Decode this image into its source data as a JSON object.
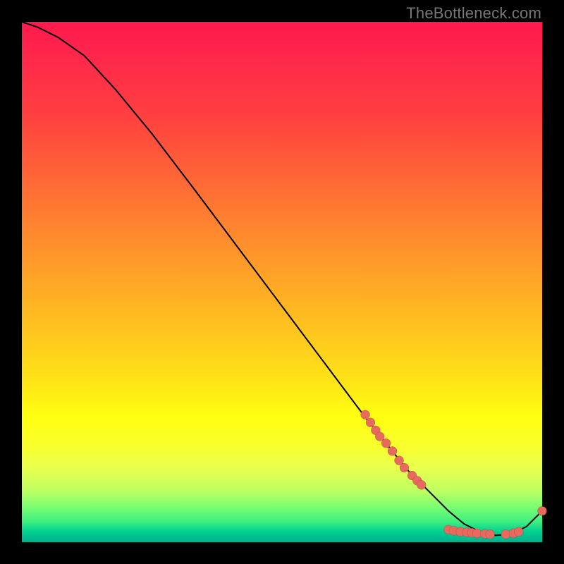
{
  "attribution": "TheBottleneck.com",
  "colors": {
    "dot": "#e86a5e",
    "curve": "#000000"
  },
  "chart_data": {
    "type": "line",
    "title": "",
    "xlabel": "",
    "ylabel": "",
    "xlim": [
      0,
      100
    ],
    "ylim": [
      0,
      100
    ],
    "grid": false,
    "series": [
      {
        "name": "bottleneck-curve",
        "x": [
          0,
          3,
          7,
          12,
          18,
          25,
          33,
          42,
          51,
          60,
          66,
          70,
          74,
          78,
          82,
          85,
          88,
          91,
          94,
          97,
          100
        ],
        "y": [
          100,
          99,
          97,
          93.5,
          87,
          78.5,
          68,
          56,
          44,
          32,
          24,
          19,
          14,
          10,
          6,
          3.5,
          2,
          1.3,
          1.5,
          3,
          6
        ]
      }
    ],
    "points": [
      {
        "name": "marker",
        "x": 66,
        "y": 24.5
      },
      {
        "name": "marker",
        "x": 67,
        "y": 23.0
      },
      {
        "name": "marker",
        "x": 68,
        "y": 21.5
      },
      {
        "name": "marker",
        "x": 68.8,
        "y": 20.3
      },
      {
        "name": "marker",
        "x": 70,
        "y": 19.0
      },
      {
        "name": "marker",
        "x": 71.2,
        "y": 17.5
      },
      {
        "name": "marker",
        "x": 72.5,
        "y": 15.7
      },
      {
        "name": "marker",
        "x": 73.5,
        "y": 14.3
      },
      {
        "name": "marker",
        "x": 75,
        "y": 12.8
      },
      {
        "name": "marker",
        "x": 76,
        "y": 11.8
      },
      {
        "name": "marker",
        "x": 76.8,
        "y": 11.0
      },
      {
        "name": "marker",
        "x": 82,
        "y": 2.4
      },
      {
        "name": "marker",
        "x": 83,
        "y": 2.2
      },
      {
        "name": "marker",
        "x": 84.3,
        "y": 2.0
      },
      {
        "name": "marker",
        "x": 85.5,
        "y": 1.9
      },
      {
        "name": "marker",
        "x": 86.5,
        "y": 1.8
      },
      {
        "name": "marker",
        "x": 87.5,
        "y": 1.7
      },
      {
        "name": "marker",
        "x": 89,
        "y": 1.6
      },
      {
        "name": "marker",
        "x": 90,
        "y": 1.5
      },
      {
        "name": "marker",
        "x": 93,
        "y": 1.5
      },
      {
        "name": "marker",
        "x": 94.5,
        "y": 1.7
      },
      {
        "name": "marker",
        "x": 95.5,
        "y": 2.0
      },
      {
        "name": "marker",
        "x": 100,
        "y": 6.0
      }
    ]
  }
}
